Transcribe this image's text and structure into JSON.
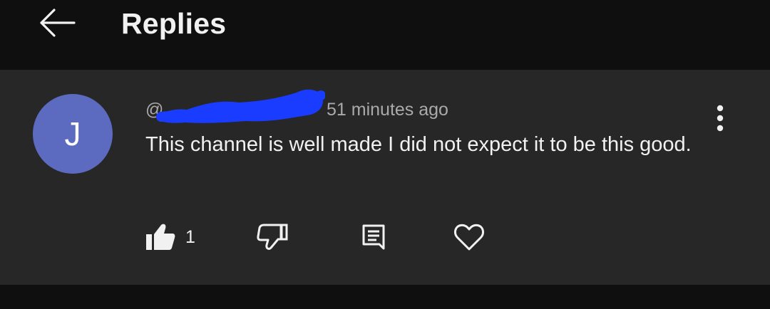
{
  "header": {
    "title": "Replies",
    "back_icon": "arrow-left-icon"
  },
  "comment": {
    "avatar_letter": "J",
    "avatar_color": "#5c6bc0",
    "handle": "@",
    "timestamp": "51 minutes ago",
    "text": "This channel is well made I did not expect it to be this good.",
    "like_count": "1",
    "more_icon": "more-vertical-icon"
  },
  "actions": {
    "like_icon": "thumbs-up-filled-icon",
    "dislike_icon": "thumbs-down-icon",
    "reply_icon": "comment-icon",
    "heart_icon": "heart-icon"
  },
  "colors": {
    "background": "#0f0f0f",
    "card": "#272727",
    "text_primary": "#f1f1f1",
    "text_secondary": "#aaaaaa",
    "redaction_blue": "#1a3cff"
  }
}
